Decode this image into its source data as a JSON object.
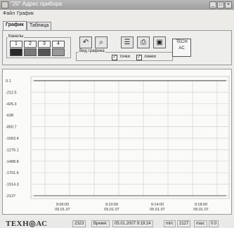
{
  "window": {
    "title": "\"20\" Адрес прибора",
    "min": "_",
    "max": "□",
    "close": "×"
  },
  "menu": [
    {
      "label": "Файл"
    },
    {
      "label": "График"
    }
  ],
  "tabs": [
    {
      "label": "График"
    },
    {
      "label": "Таблица"
    }
  ],
  "channels": {
    "label": "Каналы",
    "buttons": [
      "1",
      "2",
      "3",
      "4"
    ],
    "colors": [
      "#2a2a2a",
      "#7a7a7a",
      "#555555",
      "#9a9a9a"
    ]
  },
  "view": {
    "label": "Вид графика",
    "options": [
      {
        "label": "точки",
        "checked": true
      },
      {
        "label": "линии",
        "checked": true
      }
    ]
  },
  "bigbutton": {
    "label": "TECH AC"
  },
  "graph": {
    "y_ticks": [
      "0.1",
      "-212.5",
      "-425.3",
      "-638",
      "-850.7",
      "-1063.4",
      "-1276.1",
      "-1488.8",
      "-1701.6",
      "-1914.3",
      "-2127"
    ],
    "x_ticks": [
      {
        "time": "9:06:00",
        "date": "05.01.07"
      },
      {
        "time": "9:10:00",
        "date": "05.01.07"
      },
      {
        "time": "9:14:00",
        "date": "05.01.07"
      },
      {
        "time": "9:18:00",
        "date": "05.01.07"
      }
    ],
    "line_color": "#7a7a7a"
  },
  "status": {
    "logo": "ТЕХН◎АС",
    "value": "2323",
    "time_label": "Время:",
    "time_value": "05.01.2007 9:19:24",
    "min_label": "min:",
    "min_value": "2127",
    "max_label": "max:",
    "max_value": "0.0"
  }
}
